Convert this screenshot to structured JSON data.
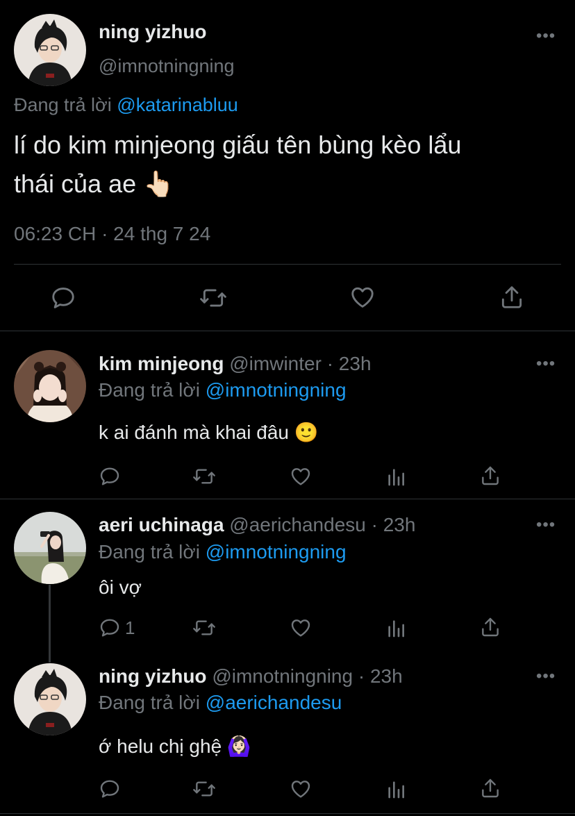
{
  "main_tweet": {
    "name": "ning yizhuo",
    "handle": "@imnotningning",
    "reply_prefix": "Đang trả lời",
    "reply_to": "@katarinabluu",
    "text_line1": "lí do kim minjeong giấu tên bùng kèo lẩu",
    "text_line2": "thái của ae 👆🏻",
    "timestamp": "06:23 CH · 24 thg 7 24"
  },
  "replies": [
    {
      "name": "kim minjeong",
      "handle": "@imwinter",
      "time": " · 23h",
      "reply_prefix": "Đang trả lời",
      "reply_to": "@imnotningning",
      "text": "k ai đánh mà khai đâu 🙂",
      "reply_count": ""
    },
    {
      "name": "aeri uchinaga",
      "handle": "@aerichandesu",
      "time": " · 23h",
      "reply_prefix": "Đang trả lời",
      "reply_to": "@imnotningning",
      "text": "ôi vợ",
      "reply_count": "1"
    },
    {
      "name": "ning yizhuo",
      "handle": "@imnotningning",
      "time": " · 23h",
      "reply_prefix": "Đang trả lời",
      "reply_to": "@aerichandesu",
      "text": "ớ helu chị ghệ 🙆🏻‍♀️",
      "reply_count": ""
    }
  ],
  "icons": {
    "more": "more-dots-icon",
    "reply": "reply-bubble-icon",
    "retweet": "retweet-icon",
    "like": "heart-icon",
    "analytics": "analytics-icon",
    "share": "share-icon"
  },
  "colors": {
    "background": "#000000",
    "text": "#e7e9ea",
    "muted": "#71767b",
    "accent": "#1d9bf0",
    "divider": "#2f3336"
  }
}
